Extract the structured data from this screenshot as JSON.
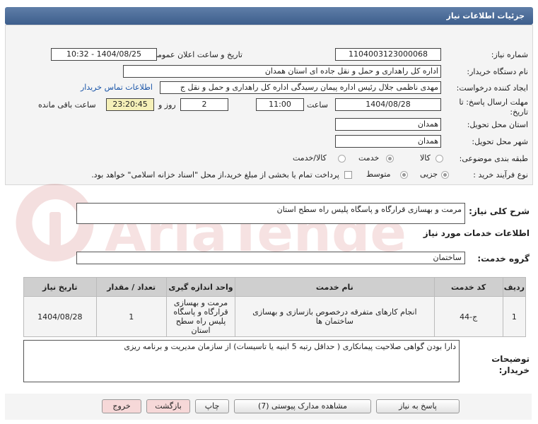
{
  "header": {
    "title": "جزئیات اطلاعات نیاز"
  },
  "form": {
    "need_number": {
      "label": "شماره نیاز:",
      "value": "1104003123000068"
    },
    "announce_datetime": {
      "label": "تاریخ و ساعت اعلان عمومی:",
      "value": "1404/08/25 - 10:32"
    },
    "buyer_org": {
      "label": "نام دستگاه خریدار:",
      "value": "اداره کل راهداری و حمل و نقل جاده ای استان همدان"
    },
    "requester": {
      "label": "ایجاد کننده درخواست:",
      "value": "مهدی ناظمی جلال رئیس اداره پیمان رسیدگی اداره کل راهداری و حمل و نقل ج",
      "contact_link": "اطلاعات تماس خریدار"
    },
    "deadline": {
      "label": "مهلت ارسال پاسخ: تا تاریخ:",
      "date": "1404/08/28",
      "time_label": "ساعت",
      "time": "11:00",
      "days": "2",
      "days_label": "روز و",
      "remaining": "23:20:45",
      "remaining_label": "ساعت باقی مانده"
    },
    "delivery_province": {
      "label": "استان محل تحویل:",
      "value": "همدان"
    },
    "delivery_city": {
      "label": "شهر محل تحویل:",
      "value": "همدان"
    },
    "category": {
      "label": "طبقه بندی موضوعی:",
      "options": [
        "کالا",
        "خدمت",
        "کالا/خدمت"
      ],
      "selected": "خدمت"
    },
    "purchase_type": {
      "label": "نوع فرآیند خرید :",
      "options": [
        "جزیی",
        "متوسط"
      ],
      "selected": "جزیی",
      "note": "پرداخت تمام یا بخشی از مبلغ خرید،از محل \"اسناد خزانه اسلامی\" خواهد بود."
    }
  },
  "description": {
    "label": "شرح کلی نیاز:",
    "value": "مرمت و بهسازی قرارگاه و پاسگاه پلیس راه سطح استان"
  },
  "services": {
    "heading": "اطلاعات خدمات مورد نیاز",
    "group_label": "گروه خدمت:",
    "group_value": "ساختمان",
    "columns": [
      "ردیف",
      "کد خدمت",
      "نام خدمت",
      "واحد اندازه گیری",
      "تعداد / مقدار",
      "تاریخ نیاز"
    ],
    "rows": [
      {
        "row": "1",
        "code": "ج-44",
        "name": "انجام کارهای متفرقه درخصوص بازسازی و بهسازی ساختمان ها",
        "unit": "مرمت و بهسازی قرارگاه و پاسگاه پلیس راه سطح استان",
        "qty": "1",
        "date": "1404/08/28"
      }
    ]
  },
  "buyer_notes": {
    "label": "توضیحات خریدار:",
    "value": "دارا بودن گواهی صلاحیت پیمانکاری ( حداقل رتبه 5  ابنیه یا تاسیسات) از سازمان مدیریت و برنامه ریزی"
  },
  "buttons": {
    "respond": "پاسخ به نیاز",
    "attachments": "مشاهده مدارک پیوستی (7)",
    "print": "چاپ",
    "back": "بازگشت",
    "exit": "خروج"
  },
  "watermark": {
    "text": "AriaTender.net"
  },
  "colors": {
    "title_bar": "#4a6a98",
    "link": "#1a55a8",
    "highlight": "#f5f0b8",
    "button_pink": "#f6d8d8"
  }
}
